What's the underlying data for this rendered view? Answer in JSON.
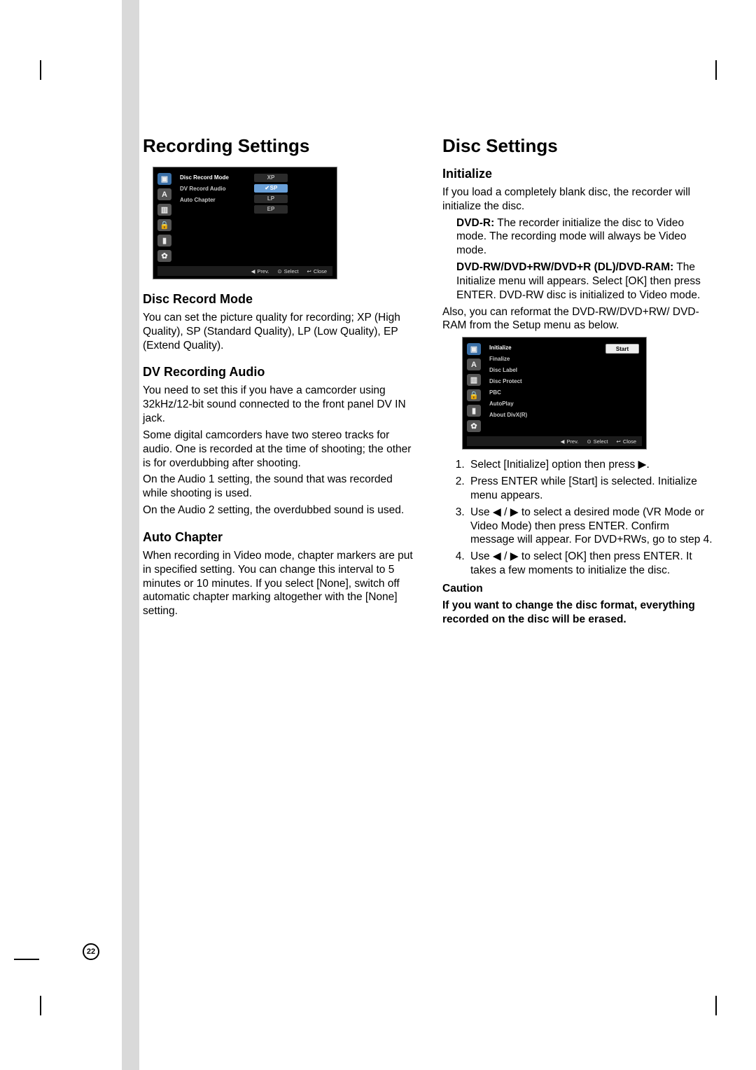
{
  "page_number": "22",
  "left": {
    "title": "Recording Settings",
    "menu1": {
      "items": [
        "Disc Record Mode",
        "DV Record Audio",
        "Auto Chapter"
      ],
      "options": [
        "XP",
        "SP",
        "LP",
        "EP"
      ],
      "selected": "SP",
      "footer": {
        "prev": "Prev.",
        "select": "Select",
        "close": "Close"
      }
    },
    "s1": {
      "h": "Disc Record Mode",
      "p1": "You can set the picture quality for recording; XP (High Quality), SP (Standard Quality), LP (Low Quality), EP (Extend Quality)."
    },
    "s2": {
      "h": "DV Recording Audio",
      "p1": "You need to set this if you have a camcorder using 32kHz/12-bit sound connected to the front panel DV IN jack.",
      "p2": "Some digital camcorders have two stereo tracks for audio. One is recorded at the time of shooting; the other is for overdubbing after shooting.",
      "p3": "On the Audio 1 setting, the sound that was recorded while shooting is used.",
      "p4": "On the Audio 2 setting, the overdubbed sound is used."
    },
    "s3": {
      "h": "Auto Chapter",
      "p1": "When recording in Video mode, chapter markers are put in specified setting. You can change this interval to 5 minutes or 10 minutes. If you select [None], switch off automatic chapter marking altogether with the [None] setting."
    }
  },
  "right": {
    "title": "Disc Settings",
    "s1": {
      "h": "Initialize",
      "p1": "If you load a completely blank disc, the recorder will initialize the disc.",
      "b1a": "DVD-R:",
      "b1b": " The recorder initialize the disc to Video mode. The recording mode will always be Video mode.",
      "b2a": "DVD-RW/DVD+RW/DVD+R (DL)/DVD-RAM:",
      "b2b": " The Initialize menu will appears. Select [OK] then press ENTER. DVD-RW disc is initialized to Video mode.",
      "p2": "Also, you can reformat the DVD-RW/DVD+RW/ DVD-RAM from the Setup menu as below."
    },
    "menu2": {
      "items": [
        "Initialize",
        "Finalize",
        "Disc Label",
        "Disc Protect",
        "PBC",
        "AutoPlay",
        "About DivX(R)"
      ],
      "selected": "Initialize",
      "button": "Start",
      "footer": {
        "prev": "Prev.",
        "select": "Select",
        "close": "Close"
      }
    },
    "steps": {
      "1": "Select [Initialize] option then press ▶.",
      "2": "Press ENTER while [Start] is selected. Initialize menu appears.",
      "3": "Use ◀ / ▶ to select a desired mode (VR Mode or Video Mode) then press ENTER. Confirm message will appear. For DVD+RWs, go to step 4.",
      "4": "Use ◀ / ▶ to select [OK] then press ENTER. It takes a few moments to initialize the disc."
    },
    "caution": {
      "h": "Caution",
      "p": "If you want to change the disc format, everything recorded on the disc will be erased."
    }
  }
}
